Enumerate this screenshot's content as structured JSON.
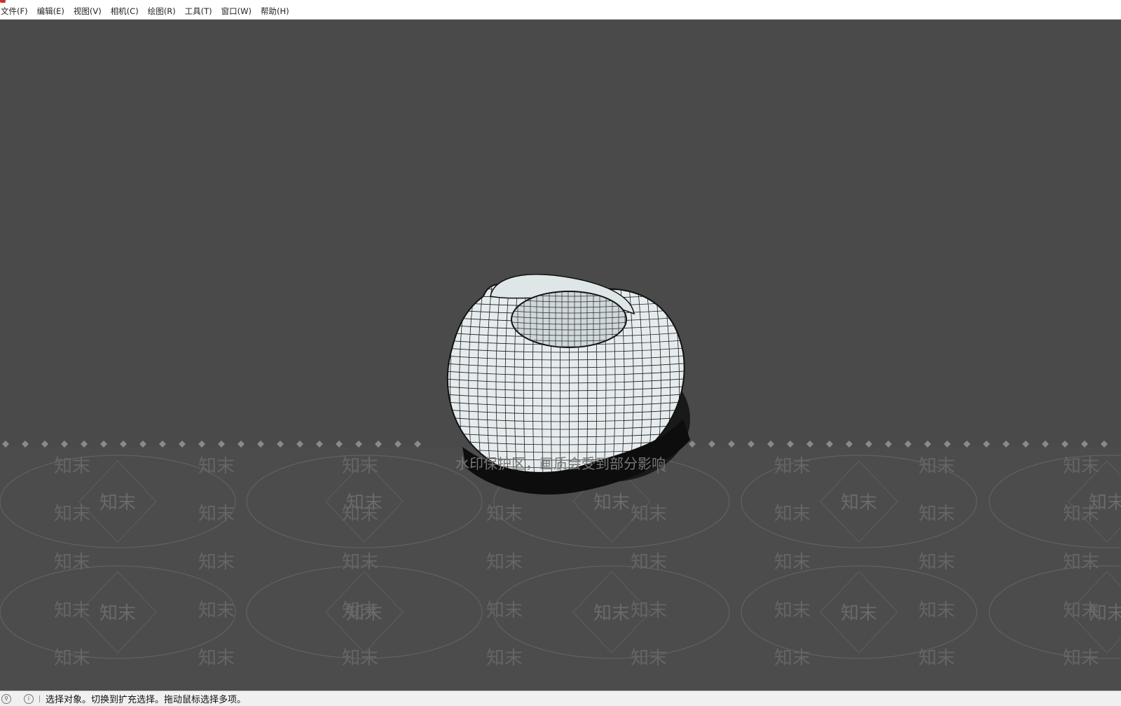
{
  "window": {
    "title": ""
  },
  "menubar": {
    "items": [
      {
        "label": "文件(F)"
      },
      {
        "label": "编辑(E)"
      },
      {
        "label": "视图(V)"
      },
      {
        "label": "相机(C)"
      },
      {
        "label": "绘图(R)"
      },
      {
        "label": "工具(T)"
      },
      {
        "label": "窗口(W)"
      },
      {
        "label": "帮助(H)"
      }
    ]
  },
  "viewport": {
    "background": "#4a4a4a",
    "model": "wireframe-vase"
  },
  "watermark": {
    "banner": "水印保护区，画质会受到部分影响",
    "tile_text": "知末",
    "badge_text": "知末"
  },
  "statusbar": {
    "message": "选择对象。切换到扩充选择。拖动鼠标选择多项。",
    "icons": [
      "geo-location-icon",
      "info-icon"
    ]
  },
  "colors": {
    "app_accent": "#c8332a",
    "model_fill": "#e8eef0",
    "wire": "#1c1c1c",
    "watermark_text": "#6e6e6e"
  }
}
